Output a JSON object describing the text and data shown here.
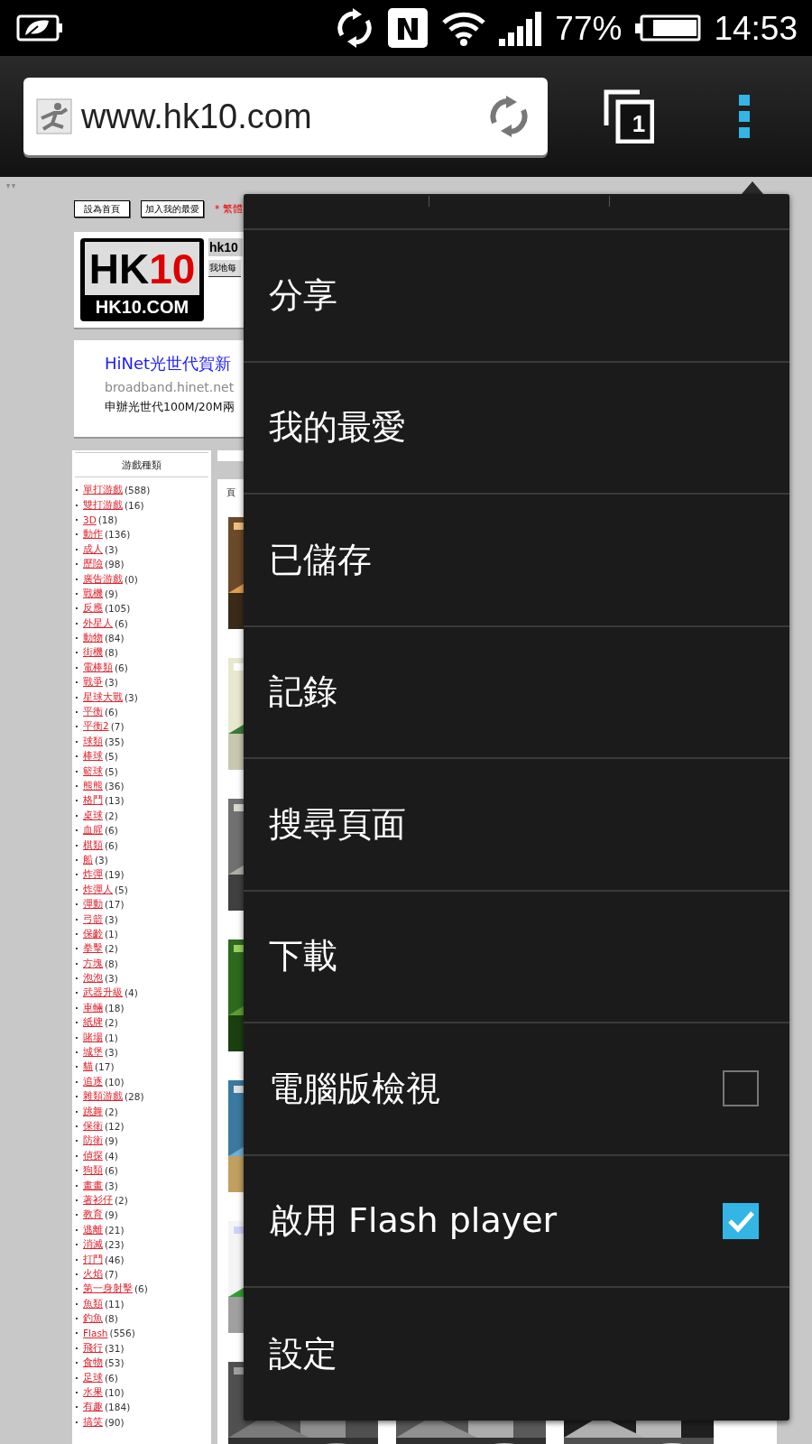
{
  "status_bar": {
    "battery_percent": "77%",
    "time": "14:53"
  },
  "address_bar": {
    "url": "www.hk10.com",
    "tab_count": "1"
  },
  "page": {
    "toolbar_buttons": [
      "設為首頁",
      "加入我的最愛"
    ],
    "language_note": "* 繁體",
    "logo": {
      "mark_prefix": "HK",
      "mark_suffix": "10",
      "caption": "HK10.COM"
    },
    "site_title": "hk10",
    "tagline": "我地每",
    "ad": {
      "title": "HiNet光世代賀新",
      "domain": "broadband.hinet.net",
      "text": "申辦光世代100M/20M兩"
    },
    "category_panel": {
      "title": "游戲種類",
      "items": [
        {
          "name": "單打游戲",
          "count": "(588)"
        },
        {
          "name": "雙打游戲",
          "count": "(16)"
        },
        {
          "name": "3D",
          "count": "(18)"
        },
        {
          "name": "動作",
          "count": "(136)"
        },
        {
          "name": "成人",
          "count": "(3)"
        },
        {
          "name": "歷險",
          "count": "(98)"
        },
        {
          "name": "廣告游戲",
          "count": "(0)"
        },
        {
          "name": "戰機",
          "count": "(9)"
        },
        {
          "name": "反應",
          "count": "(105)"
        },
        {
          "name": "外星人",
          "count": "(6)"
        },
        {
          "name": "動物",
          "count": "(84)"
        },
        {
          "name": "街機",
          "count": "(8)"
        },
        {
          "name": "電棒類",
          "count": "(6)"
        },
        {
          "name": "戰爭",
          "count": "(3)"
        },
        {
          "name": "星球大戰",
          "count": "(3)"
        },
        {
          "name": "平衡",
          "count": "(6)"
        },
        {
          "name": "平衡2",
          "count": "(7)"
        },
        {
          "name": "球類",
          "count": "(35)"
        },
        {
          "name": "棒球",
          "count": "(5)"
        },
        {
          "name": "籃球",
          "count": "(5)"
        },
        {
          "name": "熊熊",
          "count": "(36)"
        },
        {
          "name": "格鬥",
          "count": "(13)"
        },
        {
          "name": "桌球",
          "count": "(2)"
        },
        {
          "name": "血腥",
          "count": "(6)"
        },
        {
          "name": "棋類",
          "count": "(6)"
        },
        {
          "name": "船",
          "count": "(3)"
        },
        {
          "name": "炸彈",
          "count": "(19)"
        },
        {
          "name": "炸彈人",
          "count": "(5)"
        },
        {
          "name": "彈動",
          "count": "(17)"
        },
        {
          "name": "弓箭",
          "count": "(3)"
        },
        {
          "name": "保齡",
          "count": "(1)"
        },
        {
          "name": "拳擊",
          "count": "(2)"
        },
        {
          "name": "方塊",
          "count": "(8)"
        },
        {
          "name": "泡泡",
          "count": "(3)"
        },
        {
          "name": "武器升級",
          "count": "(4)"
        },
        {
          "name": "車輛",
          "count": "(18)"
        },
        {
          "name": "紙牌",
          "count": "(2)"
        },
        {
          "name": "賭場",
          "count": "(1)"
        },
        {
          "name": "城堡",
          "count": "(3)"
        },
        {
          "name": "貓",
          "count": "(17)"
        },
        {
          "name": "追逐",
          "count": "(10)"
        },
        {
          "name": "雜類游戲",
          "count": "(28)"
        },
        {
          "name": "跳舞",
          "count": "(2)"
        },
        {
          "name": "保衛",
          "count": "(12)"
        },
        {
          "name": "防衛",
          "count": "(9)"
        },
        {
          "name": "偵探",
          "count": "(4)"
        },
        {
          "name": "狗類",
          "count": "(6)"
        },
        {
          "name": "畫畫",
          "count": "(3)"
        },
        {
          "name": "著衫仔",
          "count": "(2)"
        },
        {
          "name": "教育",
          "count": "(9)"
        },
        {
          "name": "逃離",
          "count": "(21)"
        },
        {
          "name": "消滅",
          "count": "(23)"
        },
        {
          "name": "打鬥",
          "count": "(46)"
        },
        {
          "name": "火焰",
          "count": "(7)"
        },
        {
          "name": "第一身射擊",
          "count": "(6)"
        },
        {
          "name": "魚類",
          "count": "(11)"
        },
        {
          "name": "釣魚",
          "count": "(8)"
        },
        {
          "name": "Flash",
          "count": "(556)"
        },
        {
          "name": "飛行",
          "count": "(31)"
        },
        {
          "name": "食物",
          "count": "(53)"
        },
        {
          "name": "足球",
          "count": "(6)"
        },
        {
          "name": "水果",
          "count": "(10)"
        },
        {
          "name": "有趣",
          "count": "(184)"
        },
        {
          "name": "搞笑",
          "count": "(90)"
        }
      ]
    },
    "games_panel": {
      "header": "頁"
    }
  },
  "menu": {
    "items": [
      {
        "label": "分享",
        "kind": "plain"
      },
      {
        "label": "我的最愛",
        "kind": "plain"
      },
      {
        "label": "已儲存",
        "kind": "plain"
      },
      {
        "label": "記錄",
        "kind": "plain"
      },
      {
        "label": "搜尋頁面",
        "kind": "plain"
      },
      {
        "label": "下載",
        "kind": "plain"
      },
      {
        "label": "電腦版檢視",
        "kind": "checkbox",
        "checked": false
      },
      {
        "label": "啟用 Flash player",
        "kind": "checkbox",
        "checked": true
      },
      {
        "label": "設定",
        "kind": "plain"
      }
    ]
  }
}
